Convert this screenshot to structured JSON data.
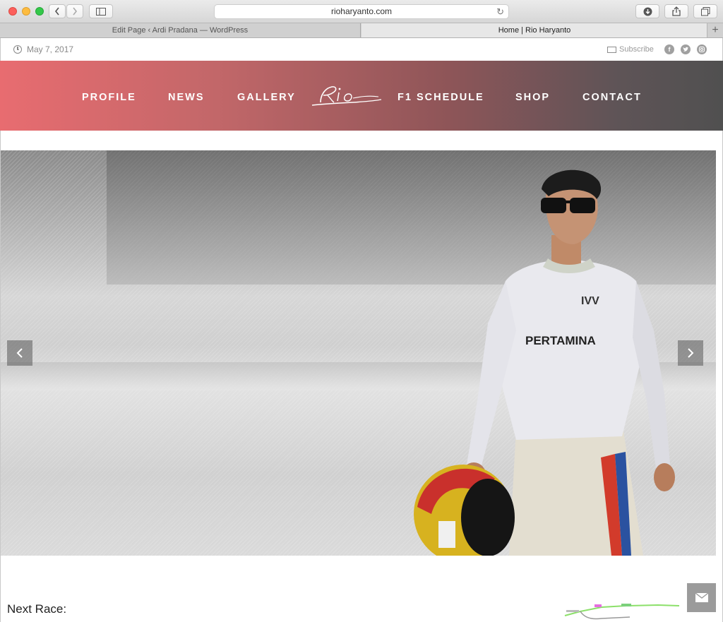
{
  "browser": {
    "url": "rioharyanto.com",
    "tabs": [
      {
        "label": "Edit Page ‹ Ardi Pradana — WordPress"
      },
      {
        "label": "Home | Rio Haryanto"
      }
    ],
    "new_tab_label": "+"
  },
  "topbar": {
    "date": "May 7, 2017",
    "subscribe": "Subscribe",
    "social": [
      "facebook-icon",
      "twitter-icon",
      "instagram-icon"
    ]
  },
  "nav": {
    "items": [
      "PROFILE",
      "NEWS",
      "GALLERY",
      "F1 SCHEDULE",
      "SHOP",
      "CONTACT"
    ],
    "logo_label": "Rio Haryanto logo"
  },
  "hero": {
    "prev": "‹",
    "next": "›",
    "shirt_text": "PERTAMINA"
  },
  "next_race": {
    "label": "Next Race:"
  },
  "colors": {
    "nav_start": "#e86c70",
    "nav_end": "#505050"
  }
}
